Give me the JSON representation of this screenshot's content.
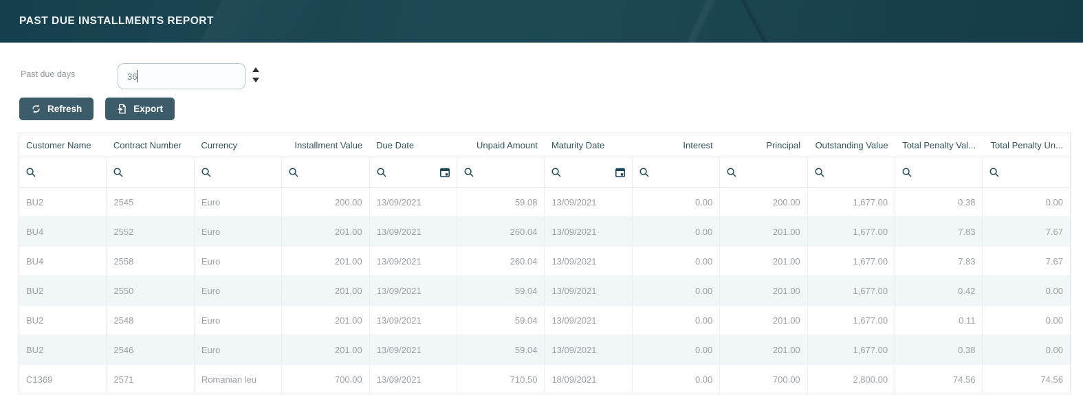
{
  "header": {
    "title": "PAST DUE INSTALLMENTS REPORT"
  },
  "controls": {
    "past_due_days": {
      "label": "Past due days",
      "value": "36"
    },
    "refresh_label": "Refresh",
    "export_label": "Export"
  },
  "table": {
    "columns": [
      {
        "label": "Customer Name",
        "align": "left",
        "filter": "search"
      },
      {
        "label": "Contract Number",
        "align": "left",
        "filter": "search"
      },
      {
        "label": "Currency",
        "align": "left",
        "filter": "search"
      },
      {
        "label": "Installment Value",
        "align": "right",
        "filter": "search"
      },
      {
        "label": "Due Date",
        "align": "left",
        "filter": "search-calendar"
      },
      {
        "label": "Unpaid Amount",
        "align": "right",
        "filter": "search"
      },
      {
        "label": "Maturity Date",
        "align": "left",
        "filter": "search-calendar"
      },
      {
        "label": "Interest",
        "align": "right",
        "filter": "search"
      },
      {
        "label": "Principal",
        "align": "right",
        "filter": "search"
      },
      {
        "label": "Outstanding Value",
        "align": "right",
        "filter": "search"
      },
      {
        "label": "Total Penalty Val...",
        "align": "right",
        "filter": "search"
      },
      {
        "label": "Total Penalty Un...",
        "align": "right",
        "filter": "search"
      }
    ],
    "rows": [
      [
        "BU2",
        "2545",
        "Euro",
        "200.00",
        "13/09/2021",
        "59.08",
        "13/09/2021",
        "0.00",
        "200.00",
        "1,677.00",
        "0.38",
        "0.00"
      ],
      [
        "BU4",
        "2552",
        "Euro",
        "201.00",
        "13/09/2021",
        "260.04",
        "13/09/2021",
        "0.00",
        "201.00",
        "1,677.00",
        "7.83",
        "7.67"
      ],
      [
        "BU4",
        "2558",
        "Euro",
        "201.00",
        "13/09/2021",
        "260.04",
        "13/09/2021",
        "0.00",
        "201.00",
        "1,677.00",
        "7.83",
        "7.67"
      ],
      [
        "BU2",
        "2550",
        "Euro",
        "201.00",
        "13/09/2021",
        "59.04",
        "13/09/2021",
        "0.00",
        "201.00",
        "1,677.00",
        "0.42",
        "0.00"
      ],
      [
        "BU2",
        "2548",
        "Euro",
        "201.00",
        "13/09/2021",
        "59.04",
        "13/09/2021",
        "0.00",
        "201.00",
        "1,677.00",
        "0.11",
        "0.00"
      ],
      [
        "BU2",
        "2546",
        "Euro",
        "201.00",
        "13/09/2021",
        "59.04",
        "13/09/2021",
        "0.00",
        "201.00",
        "1,677.00",
        "0.38",
        "0.00"
      ],
      [
        "C1369",
        "2571",
        "Romanian leu",
        "700.00",
        "13/09/2021",
        "710.50",
        "18/09/2021",
        "0.00",
        "700.00",
        "2,800.00",
        "74.56",
        "74.56"
      ]
    ]
  },
  "colors": {
    "topbar_bg": "#17404d",
    "button_bg": "#3d5c69",
    "header_text": "#31535f",
    "icon": "#1d4a5a",
    "row_alt_bg": "#f1f6f9",
    "data_text": "#9aa0a5"
  }
}
